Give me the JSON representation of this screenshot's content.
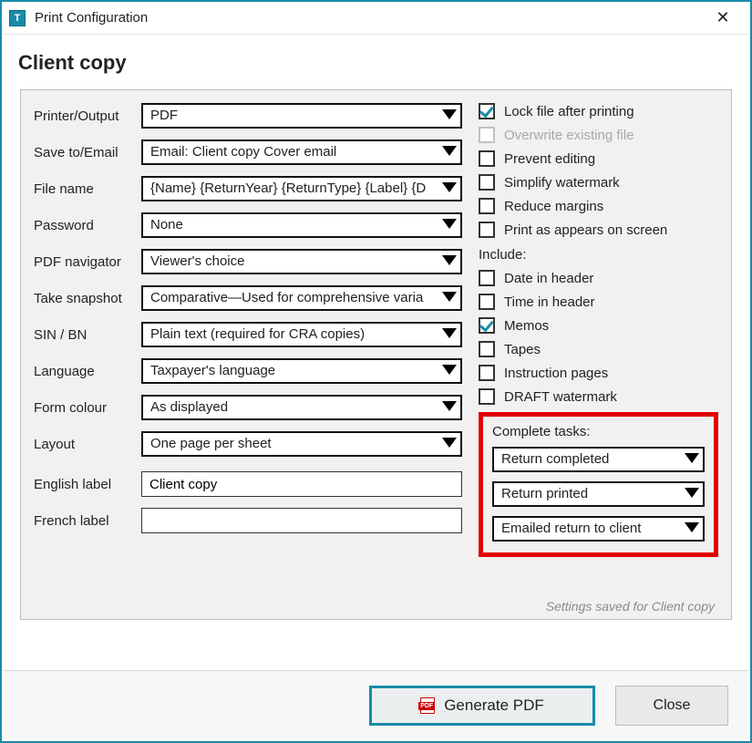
{
  "window": {
    "title": "Print Configuration",
    "icon_letter": "T"
  },
  "heading": "Client copy",
  "left": {
    "printer_output": {
      "label": "Printer/Output",
      "value": "PDF"
    },
    "save_to_email": {
      "label": "Save to/Email",
      "value": "Email: Client copy Cover email"
    },
    "file_name": {
      "label": "File name",
      "value": "{Name} {ReturnYear} {ReturnType} {Label} {D"
    },
    "password": {
      "label": "Password",
      "value": "None"
    },
    "pdf_navigator": {
      "label": "PDF navigator",
      "value": "Viewer's choice"
    },
    "take_snapshot": {
      "label": "Take snapshot",
      "value": "Comparative—Used for comprehensive varia"
    },
    "sin_bn": {
      "label": "SIN / BN",
      "value": "Plain text (required for CRA copies)"
    },
    "language": {
      "label": "Language",
      "value": "Taxpayer's language"
    },
    "form_colour": {
      "label": "Form colour",
      "value": "As displayed"
    },
    "layout": {
      "label": "Layout",
      "value": "One page per sheet"
    },
    "english_label": {
      "label": "English label",
      "value": "Client copy"
    },
    "french_label": {
      "label": "French label",
      "value": ""
    }
  },
  "right": {
    "checks_top": [
      {
        "key": "lock-file-after-printing",
        "label": "Lock file after printing",
        "checked": true,
        "disabled": false
      },
      {
        "key": "overwrite-existing-file",
        "label": "Overwrite existing file",
        "checked": false,
        "disabled": true
      },
      {
        "key": "prevent-editing",
        "label": "Prevent editing",
        "checked": false,
        "disabled": false
      },
      {
        "key": "simplify-watermark",
        "label": "Simplify watermark",
        "checked": false,
        "disabled": false
      },
      {
        "key": "reduce-margins",
        "label": "Reduce margins",
        "checked": false,
        "disabled": false
      },
      {
        "key": "print-as-appears-on-screen",
        "label": "Print as appears on screen",
        "checked": false,
        "disabled": false
      }
    ],
    "include_heading": "Include:",
    "checks_include": [
      {
        "key": "date-in-header",
        "label": "Date in header",
        "checked": false
      },
      {
        "key": "time-in-header",
        "label": "Time in header",
        "checked": false
      },
      {
        "key": "memos",
        "label": "Memos",
        "checked": true
      },
      {
        "key": "tapes",
        "label": "Tapes",
        "checked": false
      },
      {
        "key": "instruction-pages",
        "label": "Instruction pages",
        "checked": false
      },
      {
        "key": "draft-watermark",
        "label": "DRAFT watermark",
        "checked": false
      }
    ],
    "complete_tasks": {
      "heading": "Complete tasks:",
      "options": [
        "Return completed",
        "Return printed",
        "Emailed return to client"
      ]
    }
  },
  "saved_note": "Settings saved for Client copy",
  "footer": {
    "generate": "Generate PDF",
    "close": "Close"
  }
}
